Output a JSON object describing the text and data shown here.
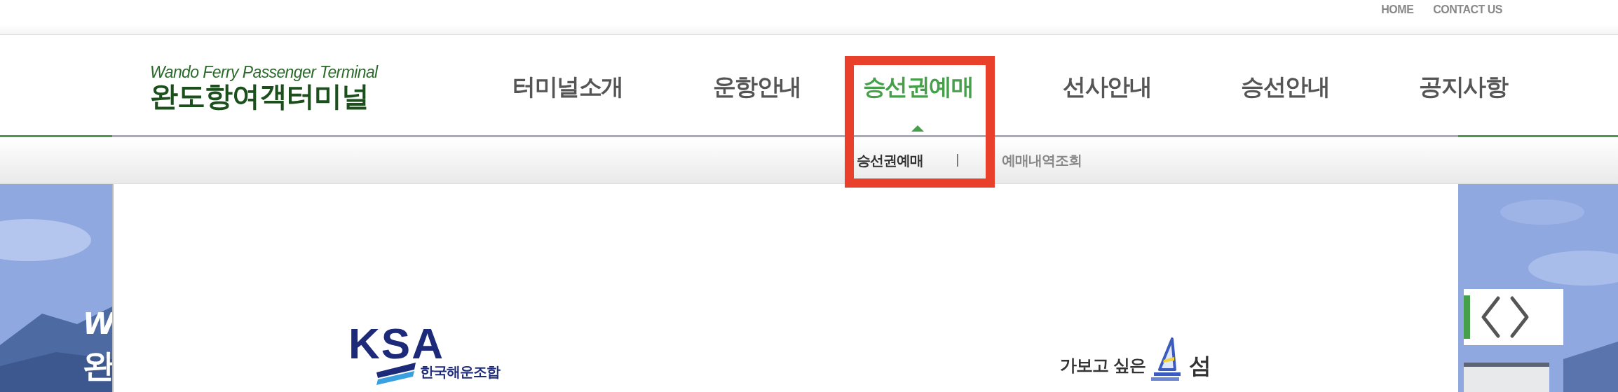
{
  "utility_links": [
    "HOME",
    "CONTACT US"
  ],
  "logo": {
    "subtitle": "Wando Ferry Passenger Terminal",
    "title": "완도항여객터미널"
  },
  "nav": [
    {
      "label": "터미널소개",
      "selected": false
    },
    {
      "label": "운항안내",
      "selected": false
    },
    {
      "label": "승선권예매",
      "selected": true
    },
    {
      "label": "선사안내",
      "selected": false
    },
    {
      "label": "승선안내",
      "selected": false
    },
    {
      "label": "공지사항",
      "selected": false
    }
  ],
  "submenu": [
    {
      "label": "승선권예매",
      "selected": true
    },
    {
      "label": "예매내역조회",
      "selected": false
    }
  ],
  "submenu_separator": "|",
  "hero_text": [
    "W",
    "완"
  ],
  "partners": [
    {
      "kind": "ksa",
      "name": "KSA",
      "caption": "한국해운조합"
    },
    {
      "kind": "island",
      "caption": "가보고 싶은",
      "name": "섬"
    }
  ]
}
